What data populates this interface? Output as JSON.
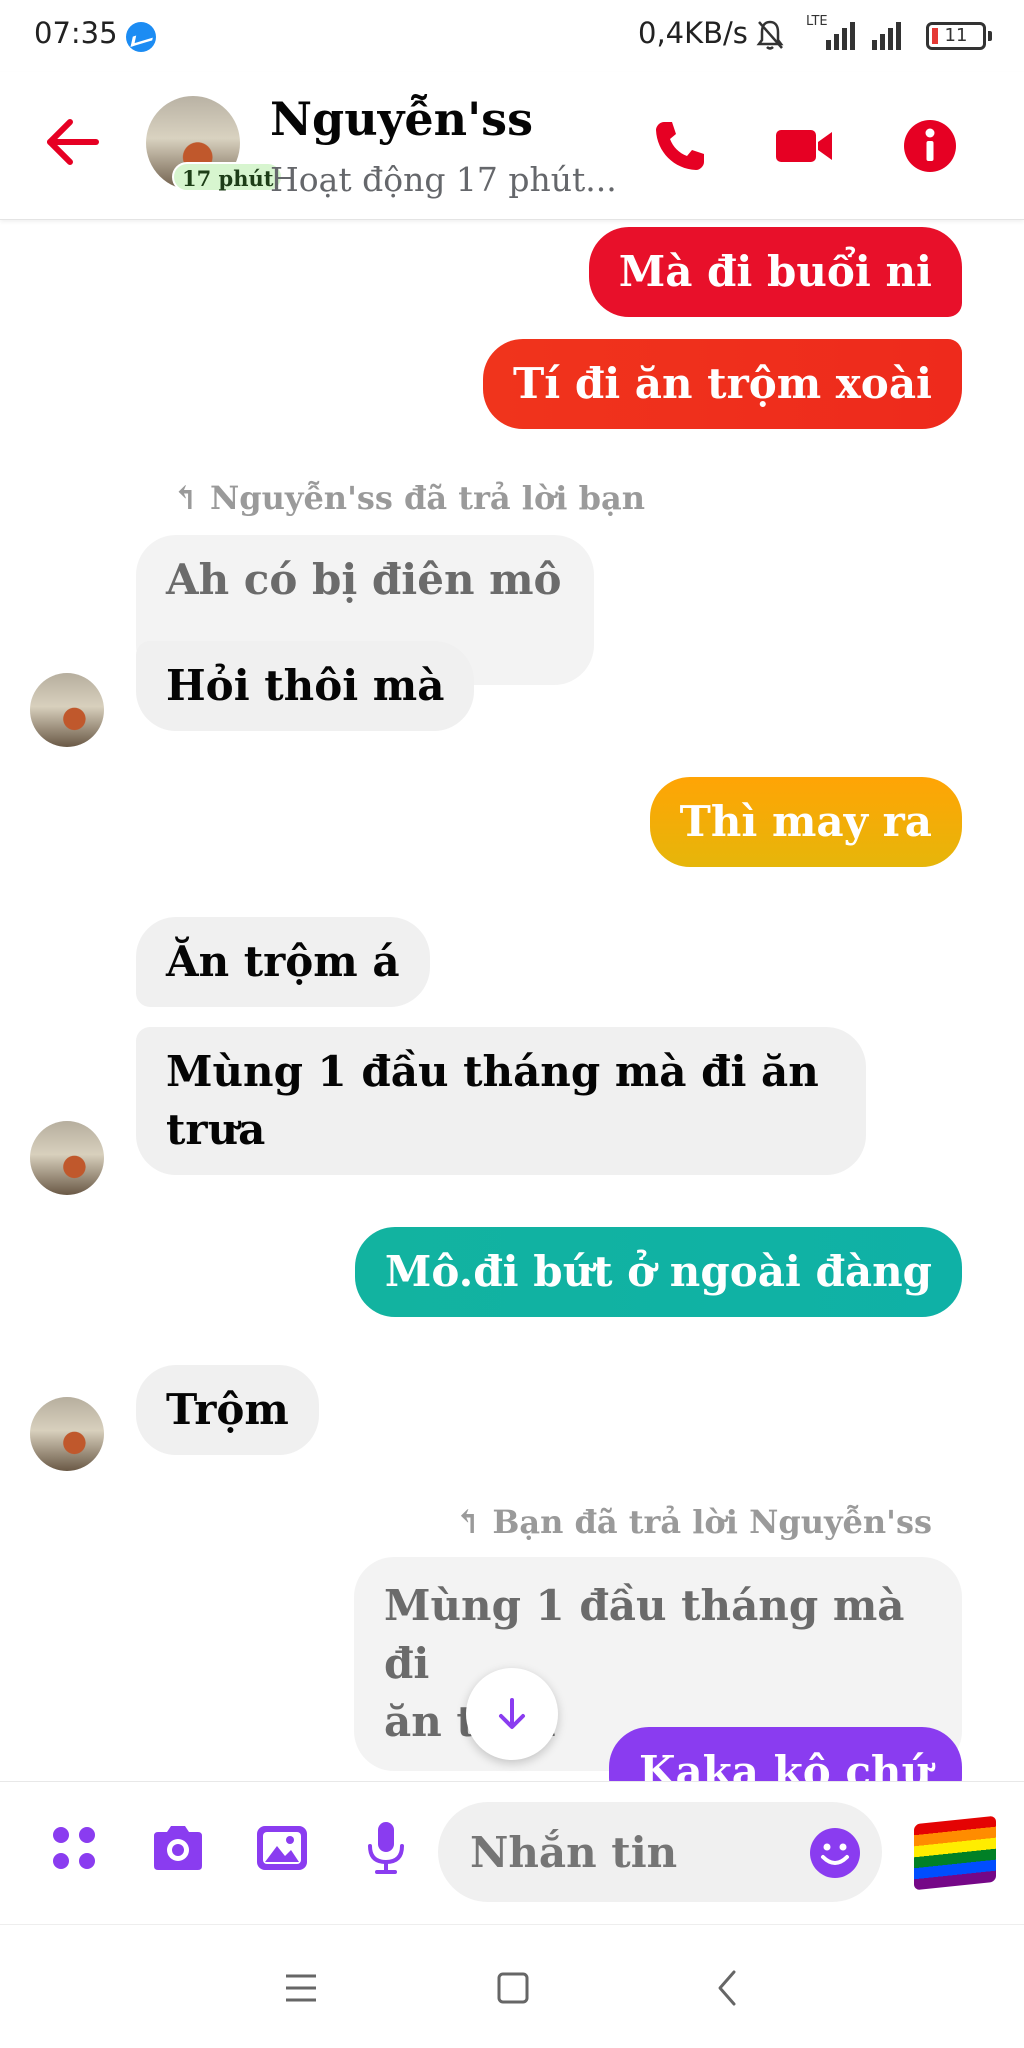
{
  "status_bar": {
    "time": "07:35",
    "network_speed": "0,4KB/s",
    "network_type": "LTE",
    "battery": "11",
    "icons": [
      "messenger-icon",
      "mute-icon",
      "signal-icon",
      "battery-icon"
    ]
  },
  "header": {
    "name": "Nguyễn'ss",
    "active_badge": "17 phút",
    "status": "Hoạt động 17 phút...",
    "icons": [
      "back-arrow-icon",
      "phone-icon",
      "video-icon",
      "info-icon"
    ],
    "accent_color": "#e60023"
  },
  "messages": [
    {
      "type": "outgoing",
      "text": "Mà đi buổi ni",
      "color": "#e8102a"
    },
    {
      "type": "outgoing",
      "text": "Tí đi ăn trộm xoài",
      "color": "#f0341c"
    },
    {
      "type": "reply_note",
      "text": "Nguyễn'ss đã trả lời bạn"
    },
    {
      "type": "quoted",
      "text": "Ah có bị điên mô"
    },
    {
      "type": "incoming",
      "text": "Hỏi thôi mà"
    },
    {
      "type": "outgoing",
      "text": "Thì may ra",
      "color": "#f3a100"
    },
    {
      "type": "incoming",
      "text": "Ăn trộm á"
    },
    {
      "type": "incoming",
      "text": "Mùng 1 đầu tháng mà đi ăn",
      "text2": "trưa"
    },
    {
      "type": "outgoing",
      "text": "Mô.đi bứt  ở ngoài đàng",
      "color": "#12b3a0"
    },
    {
      "type": "incoming",
      "text": "Trộm"
    },
    {
      "type": "reply_note",
      "text": "Bạn đã trả lời Nguyễn'ss"
    },
    {
      "type": "quoted",
      "text": "Mùng 1 đầu tháng mà đi",
      "text2": "ăn trưa"
    },
    {
      "type": "outgoing",
      "text": "Kaka kô chứ",
      "color": "#8a3cf0"
    }
  ],
  "composer": {
    "placeholder": "Nhắn tin",
    "icons": [
      "apps-icon",
      "camera-icon",
      "gallery-icon",
      "microphone-icon",
      "emoji-icon",
      "rainbow-flag-icon"
    ],
    "accent_color": "#8a3cf0"
  },
  "navbar": {
    "icons": [
      "menu-icon",
      "home-icon",
      "back-icon"
    ]
  }
}
